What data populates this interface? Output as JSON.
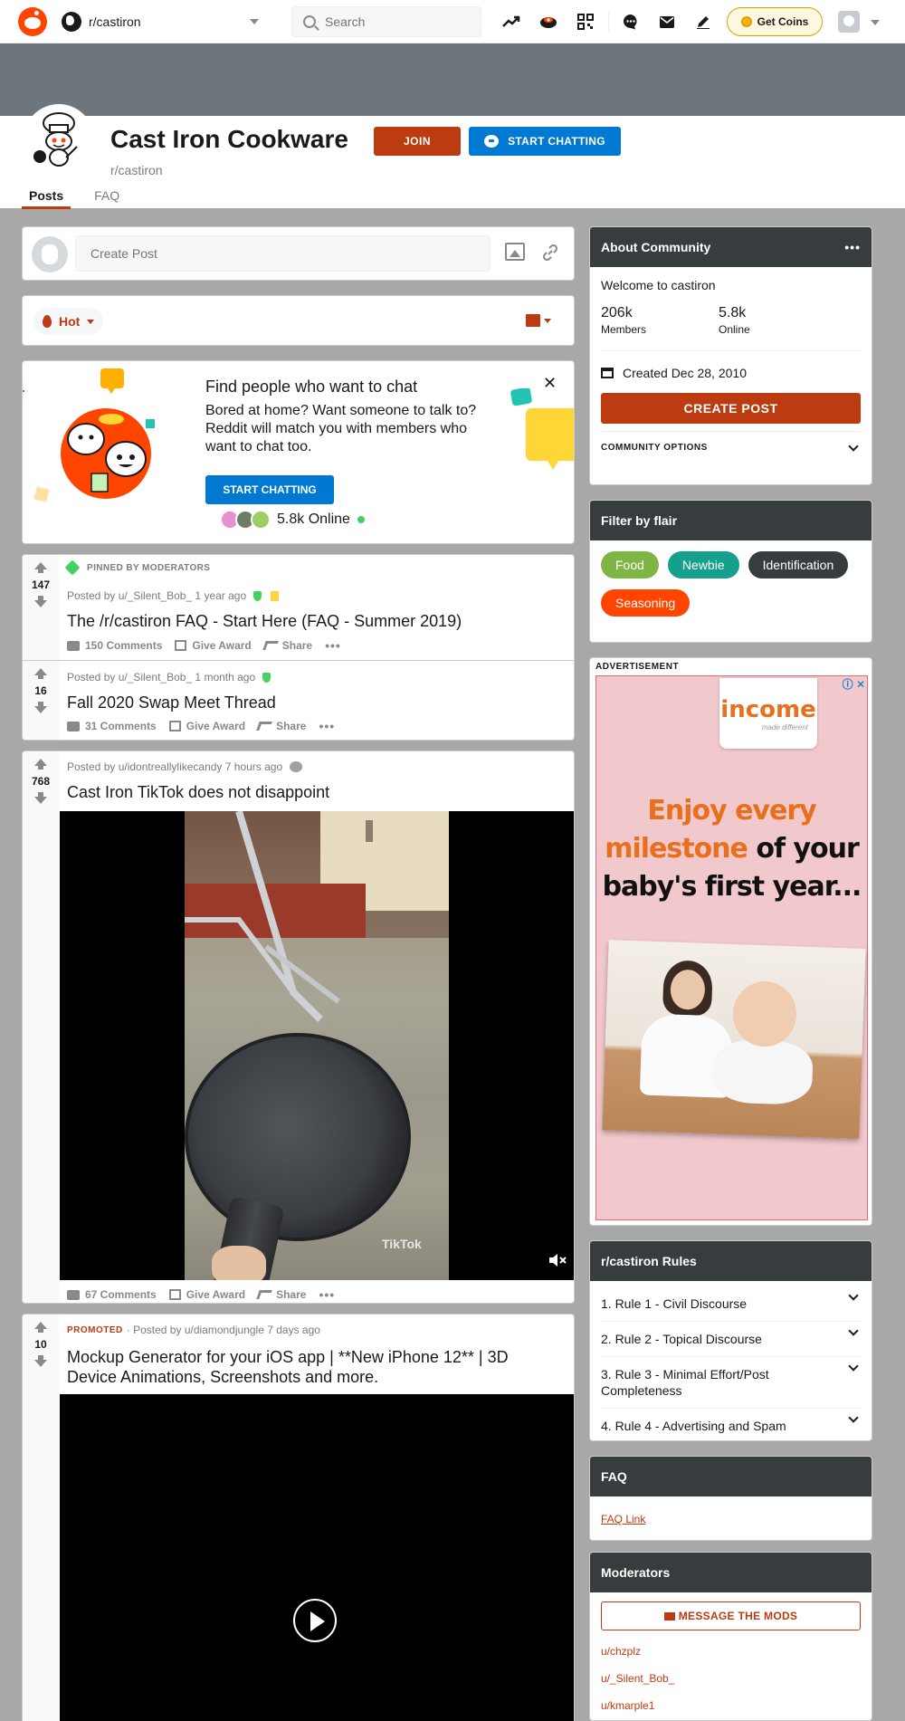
{
  "header": {
    "community": "r/castiron",
    "search_placeholder": "Search",
    "coins_label": "Get Coins"
  },
  "subreddit": {
    "title": "Cast Iron Cookware",
    "name": "r/castiron",
    "join_label": "JOIN",
    "chat_label": "START CHATTING",
    "tabs": [
      "Posts",
      "FAQ"
    ]
  },
  "create_post": {
    "placeholder": "Create Post"
  },
  "sort": {
    "label": "Hot"
  },
  "chat_card": {
    "title": "Find people who want to chat",
    "description": "Bored at home? Want someone to talk to? Reddit will match you with members who want to chat too.",
    "button": "START CHATTING",
    "online": "5.8k Online"
  },
  "posts": [
    {
      "pinned_label": "PINNED BY MODERATORS",
      "score": "147",
      "meta": "Posted by u/_Silent_Bob_ 1 year ago",
      "title": "The /r/castiron FAQ - Start Here (FAQ - Summer 2019)",
      "comments": "150 Comments",
      "award": "Give Award",
      "share": "Share"
    },
    {
      "score": "16",
      "meta": "Posted by u/_Silent_Bob_ 1 month ago",
      "title": "Fall 2020 Swap Meet Thread",
      "comments": "31 Comments",
      "award": "Give Award",
      "share": "Share"
    },
    {
      "score": "768",
      "meta": "Posted by u/idontreallylikecandy 7 hours ago",
      "title": "Cast Iron TikTok does not disappoint",
      "video_watermark": "TikTok",
      "comments": "67 Comments",
      "award": "Give Award",
      "share": "Share"
    },
    {
      "promoted_label": "PROMOTED",
      "score": "10",
      "meta": "· Posted by u/diamondjungle 7 days ago",
      "title": "Mockup Generator for your iOS app | **New iPhone 12** | 3D Device Animations, Screenshots and more."
    }
  ],
  "about": {
    "heading": "About Community",
    "welcome": "Welcome to castiron",
    "members_value": "206k",
    "members_label": "Members",
    "online_value": "5.8k",
    "online_label": "Online",
    "created": "Created Dec 28, 2010",
    "create_button": "CREATE POST",
    "options_label": "COMMUNITY OPTIONS"
  },
  "flair_filter": {
    "heading": "Filter by flair",
    "flairs": [
      {
        "label": "Food",
        "color": "#7fb543"
      },
      {
        "label": "Newbie",
        "color": "#14a08d"
      },
      {
        "label": "Identification",
        "color": "#373c3f"
      },
      {
        "label": "Seasoning",
        "color": "#ff4500"
      }
    ]
  },
  "ad": {
    "label": "ADVERTISEMENT",
    "brand": "income",
    "brand_tagline": "made different",
    "headline_a": "Enjoy every",
    "headline_b": "milestone",
    "headline_c": "of your",
    "headline_d": "baby's first year..."
  },
  "rules": {
    "heading": "r/castiron Rules",
    "items": [
      "1. Rule 1 - Civil Discourse",
      "2. Rule 2 - Topical Discourse",
      "3. Rule 3 - Minimal Effort/Post Completeness",
      "4. Rule 4 - Advertising and Spam"
    ]
  },
  "faq": {
    "heading": "FAQ",
    "link": "FAQ Link"
  },
  "moderators": {
    "heading": "Moderators",
    "message_button": "MESSAGE THE MODS",
    "list": [
      "u/chzplz",
      "u/_Silent_Bob_",
      "u/kmarple1"
    ]
  },
  "colors": {
    "accent": "#bc3b10",
    "blue": "#0079d3",
    "banner": "#6d757d",
    "sidebar_head": "#373c3f"
  }
}
